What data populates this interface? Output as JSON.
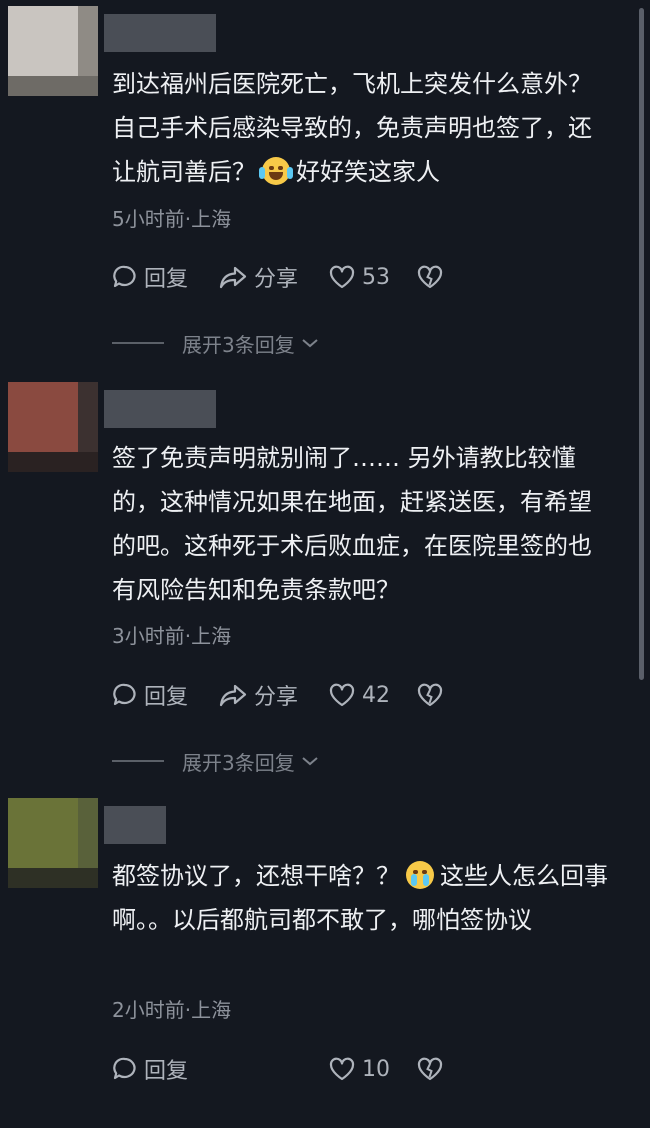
{
  "comments": [
    {
      "text_1": "到达福州后医院死亡，飞机上突发什么意外？自己手术后感染导致的，免责声明也签了，还让航司善后？",
      "emoji": "laughing-tears",
      "text_2": "好好笑这家人",
      "meta": "5小时前·上海",
      "reply_label": "回复",
      "share_label": "分享",
      "likes": "53",
      "expand_label": "展开3条回复"
    },
    {
      "text_1": "签了免责声明就别闹了…… 另外请教比较懂的，这种情况如果在地面，赶紧送医，有希望的吧。这种死于术后败血症，在医院里签的也有风险告知和免责条款吧？",
      "meta": "3小时前·上海",
      "reply_label": "回复",
      "share_label": "分享",
      "likes": "42",
      "expand_label": "展开3条回复"
    },
    {
      "text_1": "都签协议了，还想干啥？？",
      "emoji": "crying",
      "text_2": "这些人怎么回事啊。。以后都航司都不敢了，哪怕签协议",
      "meta": "2小时前·上海",
      "reply_label": "回复",
      "likes": "10"
    }
  ],
  "colors": {
    "background": "#141820",
    "avatar_1": [
      "#c9c5c0",
      "#8f8b85",
      "#6e6b66"
    ],
    "avatar_2": [
      "#8a4a40",
      "#3c3130",
      "#2a2222"
    ],
    "avatar_3": [
      "#6a7338",
      "#59613a",
      "#2e3025"
    ]
  }
}
